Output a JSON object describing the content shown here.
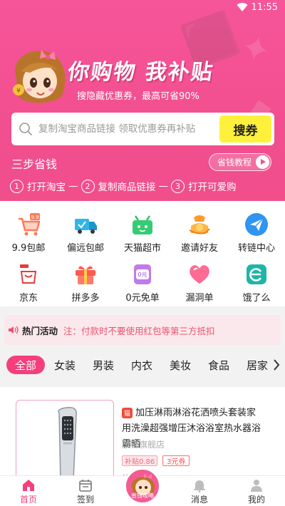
{
  "status_bar": {
    "time": "11:55"
  },
  "hero": {
    "slogan": "你购物 我补贴",
    "subslogan": "搜隐藏优惠券，最高可省90%",
    "search": {
      "placeholder": "复制淘宝商品链接 领取优惠券再补贴",
      "button_label": "搜券"
    },
    "steps_title": "三步省钱",
    "tutorial_label": "省钱教程",
    "steps": [
      {
        "num": "1",
        "label": "打开淘宝"
      },
      {
        "num": "2",
        "label": "复制商品链接"
      },
      {
        "num": "3",
        "label": "打开可爱购"
      }
    ],
    "step_separator": "—"
  },
  "categories": [
    {
      "label": "9.9包邮",
      "icon": "cart-icon",
      "badge": "9.9"
    },
    {
      "label": "偏远包邮",
      "icon": "truck-icon"
    },
    {
      "label": "天猫超市",
      "icon": "tmall-basket-icon"
    },
    {
      "label": "邀请好友",
      "icon": "coin-hand-icon"
    },
    {
      "label": "转链中心",
      "icon": "send-icon"
    },
    {
      "label": "京东",
      "icon": "jd-icon"
    },
    {
      "label": "拼多多",
      "icon": "gift-icon"
    },
    {
      "label": "0元免单",
      "icon": "zero-coupon-icon",
      "badge": "0元"
    },
    {
      "label": "漏洞单",
      "icon": "heart-icon"
    },
    {
      "label": "饿了么",
      "icon": "eleme-icon"
    }
  ],
  "hot": {
    "label": "热门活动",
    "note": "注：付款时不要使用红包等第三方抵扣"
  },
  "tabs": [
    "全部",
    "女装",
    "男装",
    "内衣",
    "美妆",
    "食品",
    "居家"
  ],
  "product": {
    "badge": "猫",
    "title": "加压淋雨淋浴花洒喷头套装家用洗澡超强增压沐浴浴室热水器浴霸晒",
    "shop": "靓锦旗舰店",
    "subsidy": "补贴0.86",
    "coupon": "3元券",
    "price_peek": "￥"
  },
  "bottom_nav": {
    "items": [
      {
        "label": "首页",
        "icon": "home-icon"
      },
      {
        "label": "签到",
        "icon": "calendar-icon"
      },
      {
        "label": "",
        "icon": ""
      },
      {
        "label": "消息",
        "icon": "bell-icon"
      },
      {
        "label": "我的",
        "icon": "user-icon"
      }
    ],
    "center_label": "省钱攻略"
  },
  "colors": {
    "brand_pink": "#f14f8f",
    "accent_yellow": "#fff13b",
    "tab_active": "#f43f7c",
    "hot_note": "#f0506d"
  }
}
